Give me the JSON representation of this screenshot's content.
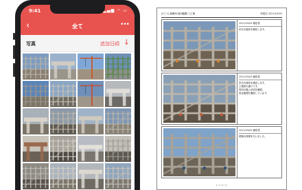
{
  "phone": {
    "status_time": "9:41",
    "status_icons": "▂▄▆ ◠ ▭",
    "nav": {
      "back": "‹",
      "title": "全て",
      "more": "•••"
    },
    "section": {
      "label": "写真",
      "add_label": "追加日順",
      "sort_icon": "↓"
    },
    "colors": {
      "accent": "#e8534f"
    },
    "photos": [
      {
        "sky": "#7d9cc0",
        "ground": "#8a8072",
        "frame": "#b8b3a8",
        "kind": "scaffold"
      },
      {
        "sky": "#9bb2cc",
        "ground": "#9a948a",
        "frame": "#d0ccc4",
        "kind": "beam"
      },
      {
        "sky": "#7fa8d8",
        "ground": "#a09280",
        "frame": "#c8582a",
        "kind": "crane"
      },
      {
        "sky": "#6f8fb5",
        "ground": "#8f8f8f",
        "frame": "#4f8a3c",
        "kind": "scaffold"
      },
      {
        "sky": "#5b84b8",
        "ground": "#7d7565",
        "frame": "#9c978e",
        "kind": "scaffold"
      },
      {
        "sky": "#8aa6c4",
        "ground": "#6f6a60",
        "frame": "#c7c2b8",
        "kind": "scaffold"
      },
      {
        "sky": "#6e8fb8",
        "ground": "#9e9688",
        "frame": "#c0513a",
        "kind": "crane"
      },
      {
        "sky": "#b5b9be",
        "ground": "#6d6a65",
        "frame": "#e0ddd8",
        "kind": "beam"
      },
      {
        "sky": "#a8b0b8",
        "ground": "#7a7367",
        "frame": "#d9d4ca",
        "kind": "beam"
      },
      {
        "sky": "#8c9aa8",
        "ground": "#5f5a52",
        "frame": "#bfb8ab",
        "kind": "scaffold"
      },
      {
        "sky": "#9fb3c8",
        "ground": "#857d70",
        "frame": "#cfc9be",
        "kind": "beam"
      },
      {
        "sky": "#7f97b4",
        "ground": "#8a8478",
        "frame": "#bcb6aa",
        "kind": "scaffold"
      },
      {
        "sky": "#c9c4bb",
        "ground": "#6b6157",
        "frame": "#9a6a4e",
        "kind": "beam"
      },
      {
        "sky": "#a7a39b",
        "ground": "#4f4a44",
        "frame": "#d6d1c8",
        "kind": "scaffold"
      },
      {
        "sky": "#b8bcc2",
        "ground": "#7a756d",
        "frame": "#e4e0da",
        "kind": "beam"
      },
      {
        "sky": "#c3c0ba",
        "ground": "#5d5850",
        "frame": "#9d9a92",
        "kind": "scaffold"
      },
      {
        "sky": "#8e8a84",
        "ground": "#5a544c",
        "frame": "#c2bdb4",
        "kind": "scaffold"
      },
      {
        "sky": "#aab4be",
        "ground": "#7c766c",
        "frame": "#d2cdc4",
        "kind": "scaffold"
      },
      {
        "sky": "#b3b7bc",
        "ground": "#6f6a62",
        "frame": "#dcd8d0",
        "kind": "beam"
      },
      {
        "sky": "#8fa5bd",
        "ground": "#7e7a72",
        "frame": "#c8c3ba",
        "kind": "scaffold"
      }
    ]
  },
  "document": {
    "title": "[ｻﾝﾌﾟﾙ] 新築RC造5階建ﾋﾞﾙ工事",
    "date": "作成日 2021/03/05",
    "footer": "1 / 1 ページ",
    "rows": [
      {
        "date": "2021/03/05",
        "status": "報告書",
        "note": "本日の進捗を報告します。",
        "photo": {
          "sky": "#7b98b8",
          "ground": "#6e6252",
          "frame": "#b5aea2",
          "accent": "#d8822f"
        }
      },
      {
        "date": "2021/03/05",
        "status": "報告書",
        "note": "本日の進捗を報告します。\n工程表の通りです。\n資材の搬入状況を確認。\n安全管理を徹底しています。",
        "photo": {
          "sky": "#8aa0b6",
          "ground": "#5e5447",
          "frame": "#bdb6aa",
          "accent": "#c45a3a"
        }
      },
      {
        "date": "2021/03/05",
        "status": "報告書",
        "note": "現場の清掃を行いました。",
        "photo": {
          "sky": "#7fa3c9",
          "ground": "#6d6557",
          "frame": "#a9a398",
          "accent": "#2f4f7a"
        }
      }
    ]
  }
}
